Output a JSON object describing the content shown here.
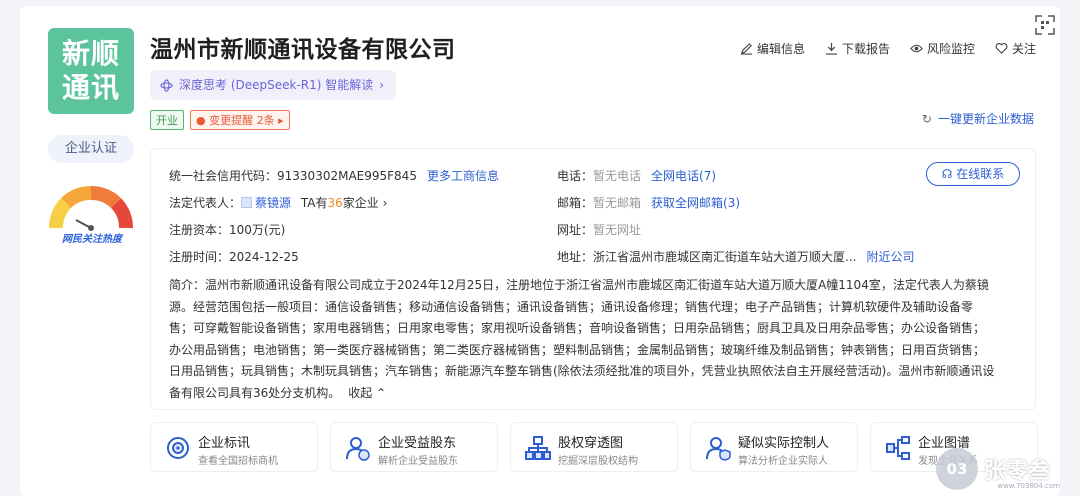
{
  "company": {
    "logo_text": "新顺通讯",
    "name": "温州市新顺通讯设备有限公司",
    "deepseek_label": "深度思考 (DeepSeek-R1) 智能解读",
    "status_tag": "开业",
    "change_tag": "变更提醒 2条",
    "cert_button": "企业认证",
    "heat_label": "网民关注热度"
  },
  "actions": [
    {
      "label": "编辑信息",
      "icon": "edit-icon"
    },
    {
      "label": "下载报告",
      "icon": "download-icon"
    },
    {
      "label": "风险监控",
      "icon": "eye-icon"
    },
    {
      "label": "关注",
      "icon": "heart-icon"
    }
  ],
  "refresh_label": "一键更新企业数据",
  "info": {
    "credit_code_label": "统一社会信用代码：",
    "credit_code": "91330302MAE995F845",
    "more_biz_info": "更多工商信息",
    "legal_rep_label": "法定代表人：",
    "legal_rep": "蔡镜源",
    "legal_rep_ta_prefix": "TA有",
    "legal_rep_count": "36",
    "legal_rep_ta_suffix": "家企业",
    "capital_label": "注册资本：",
    "capital": "100万(元)",
    "reg_date_label": "注册时间：",
    "reg_date": "2024-12-25",
    "phone_label": "电话：",
    "phone": "暂无电话",
    "phone_link": "全网电话(7)",
    "email_label": "邮箱：",
    "email": "暂无邮箱",
    "email_link": "获取全网邮箱(3)",
    "website_label": "网址：",
    "website": "暂无网址",
    "address_label": "地址：",
    "address": "浙江省温州市鹿城区南汇街道车站大道万顺大厦...",
    "nearby_link": "附近公司",
    "contact_button": "在线联系",
    "intro_lines": [
      "简介：温州市新顺通讯设备有限公司成立于2024年12月25日，注册地位于浙江省温州市鹿城区南汇街道车站大道万顺大厦A幢1104室，法定代表人为蔡镜",
      "源。经营范围包括一般项目：通信设备销售；移动通信设备销售；通讯设备销售；通讯设备修理；销售代理；电子产品销售；计算机软硬件及辅助设备零",
      "售；可穿戴智能设备销售；家用电器销售；日用家电零售；家用视听设备销售；音响设备销售；日用杂品销售；厨具卫具及日用杂品零售；办公设备销售；",
      "办公用品销售；电池销售；第一类医疗器械销售；第二类医疗器械销售；塑料制品销售；金属制品销售；玻璃纤维及制品销售；钟表销售；日用百货销售；",
      "日用品销售；玩具销售；木制玩具销售；汽车销售；新能源汽车整车销售(除依法须经批准的项目外，凭营业执照依法自主开展经营活动)。温州市新顺通讯设",
      "备有限公司具有36处分支机构。"
    ],
    "fold_label": "收起"
  },
  "features": [
    {
      "title": "企业标讯",
      "desc": "查看全国招标商机",
      "icon": "target-icon"
    },
    {
      "title": "企业受益股东",
      "desc": "解析企业受益股东",
      "icon": "shareholder-icon"
    },
    {
      "title": "股权穿透图",
      "desc": "挖掘深层股权结构",
      "icon": "equity-tree-icon"
    },
    {
      "title": "疑似实际控制人",
      "desc": "算法分析企业实际人",
      "icon": "controller-icon"
    },
    {
      "title": "企业图谱",
      "desc": "发现企业关系",
      "icon": "graph-icon"
    }
  ],
  "watermark": {
    "name": "张零叁",
    "badge": "03",
    "url": "www.703804.com"
  },
  "colors": {
    "accent": "#2d5fd3",
    "logo_bg": "#5cc49d",
    "orange": "#f08a24"
  }
}
